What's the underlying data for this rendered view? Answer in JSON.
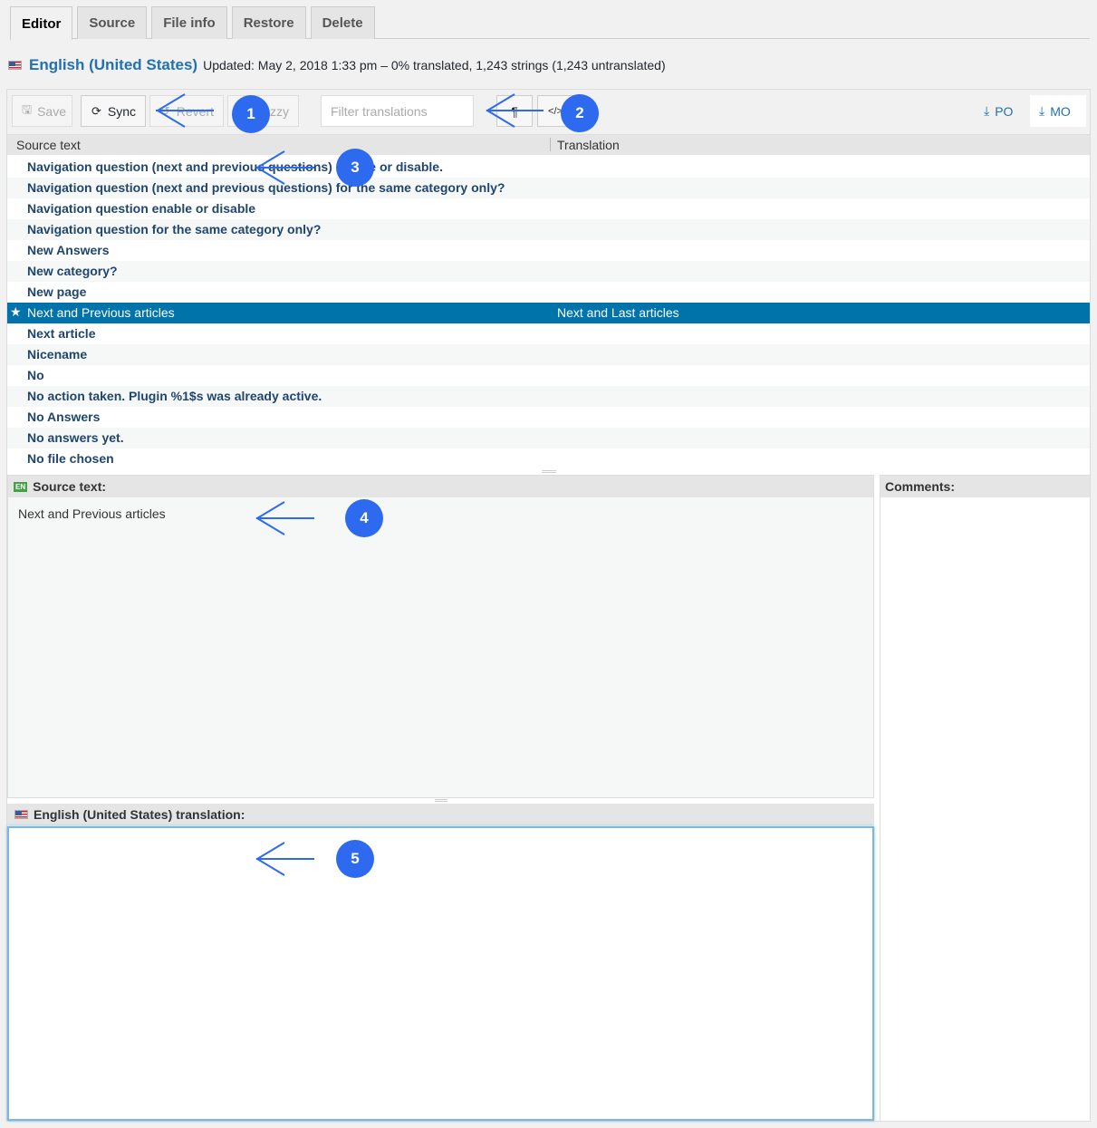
{
  "tabs": [
    {
      "label": "Editor"
    },
    {
      "label": "Source"
    },
    {
      "label": "File info"
    },
    {
      "label": "Restore"
    },
    {
      "label": "Delete"
    }
  ],
  "header": {
    "language": "English (United States)",
    "status": "Updated: May 2, 2018 1:33 pm – 0% translated, 1,243 strings (1,243 untranslated)"
  },
  "toolbar": {
    "save": "Save",
    "sync": "Sync",
    "revert": "Revert",
    "fuzzy": "zzy",
    "filter_placeholder": "Filter translations",
    "pilcrow": "¶",
    "code": "</>",
    "po": "PO",
    "mo": "MO"
  },
  "list": {
    "col_source": "Source text",
    "col_translation": "Translation",
    "rows": [
      {
        "source": "Navigation question (next and previous questions) enable or disable.",
        "translation": ""
      },
      {
        "source": "Navigation question (next and previous questions) for the same category only?",
        "translation": ""
      },
      {
        "source": "Navigation question enable or disable",
        "translation": ""
      },
      {
        "source": "Navigation question for the same category only?",
        "translation": ""
      },
      {
        "source": "New Answers",
        "translation": ""
      },
      {
        "source": "New category?",
        "translation": ""
      },
      {
        "source": "New page",
        "translation": ""
      },
      {
        "source": "Next and Previous articles",
        "translation": "Next and Last articles"
      },
      {
        "source": "Next article",
        "translation": ""
      },
      {
        "source": "Nicename",
        "translation": ""
      },
      {
        "source": "No",
        "translation": ""
      },
      {
        "source": "No action taken. Plugin %1$s was already active.",
        "translation": ""
      },
      {
        "source": "No Answers",
        "translation": ""
      },
      {
        "source": "No answers yet.",
        "translation": ""
      },
      {
        "source": "No file chosen",
        "translation": ""
      }
    ]
  },
  "source_panel": {
    "badge": "EN",
    "title": "Source text:",
    "text": "Next and Previous articles"
  },
  "translation_panel": {
    "title": "English (United States) translation:"
  },
  "comments_panel": {
    "title": "Comments:"
  },
  "callouts": [
    "1",
    "2",
    "3",
    "4",
    "5"
  ],
  "colors": {
    "accent": "#2271b1",
    "selected_row": "#0073aa",
    "callout": "#2d6af0"
  }
}
